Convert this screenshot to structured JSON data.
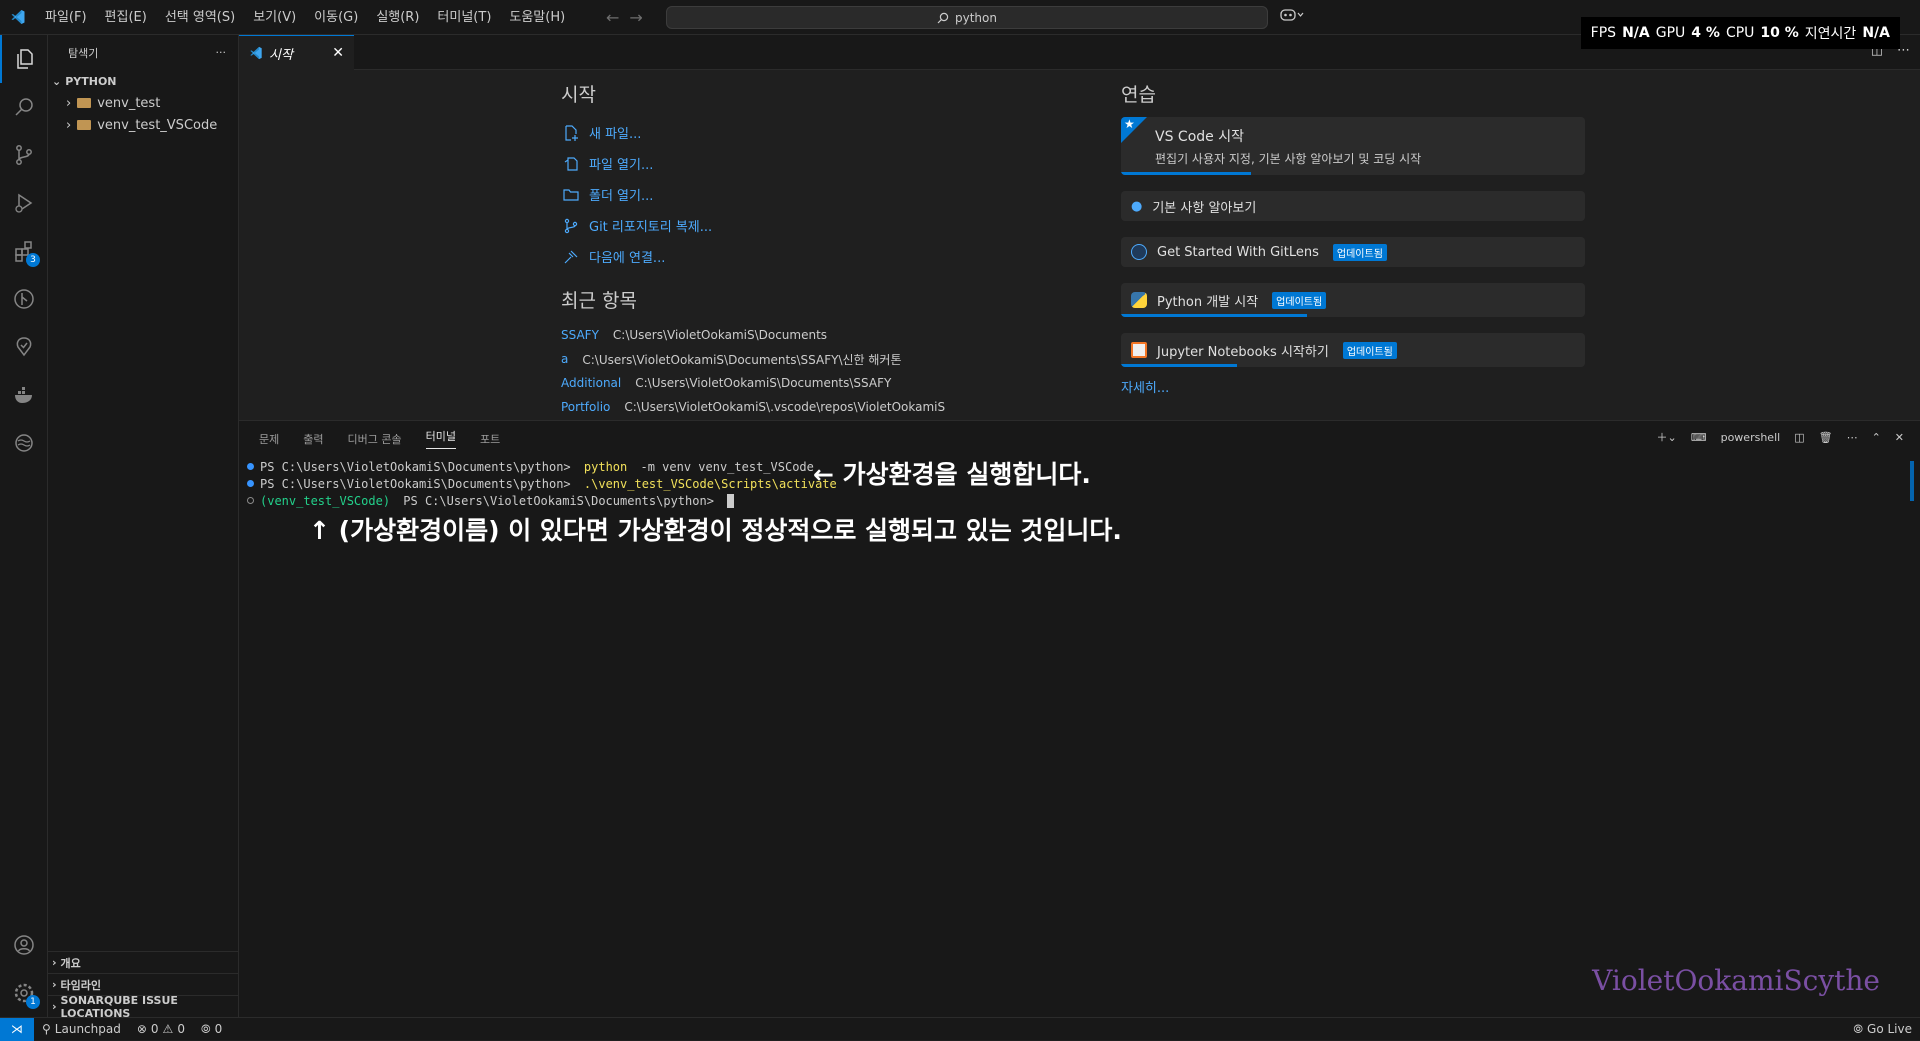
{
  "titlebar": {
    "menu": [
      "파일(F)",
      "편집(E)",
      "선택 영역(S)",
      "보기(V)",
      "이동(G)",
      "실행(R)",
      "터미널(T)",
      "도움말(H)"
    ],
    "search": "python"
  },
  "perf": {
    "fps_label": "FPS",
    "fps": "N/A",
    "gpu_label": "GPU",
    "gpu": "4 %",
    "cpu_label": "CPU",
    "cpu": "10 %",
    "latency_label": "지연시간",
    "latency": "N/A"
  },
  "activity": {
    "extensions_badge": "3",
    "settings_badge": "1"
  },
  "sidebar": {
    "title": "탐색기",
    "more": "···",
    "section": "PYTHON",
    "items": [
      {
        "label": "venv_test"
      },
      {
        "label": "venv_test_VSCode"
      }
    ],
    "bottom_sections": [
      "개요",
      "타임라인",
      "SONARQUBE ISSUE LOCATIONS"
    ]
  },
  "tab": {
    "label": "시작",
    "close": "✕"
  },
  "welcome": {
    "start_title": "시작",
    "start_links": [
      "새 파일...",
      "파일 열기...",
      "폴더 열기...",
      "Git 리포지토리 복제...",
      "다음에 연결..."
    ],
    "recent_title": "최근 항목",
    "recent": [
      {
        "name": "SSAFY",
        "path": "C:\\Users\\VioletOokamiS\\Documents"
      },
      {
        "name": "a",
        "path": "C:\\Users\\VioletOokamiS\\Documents\\SSAFY\\신한 해커톤"
      },
      {
        "name": "Additional",
        "path": "C:\\Users\\VioletOokamiS\\Documents\\SSAFY"
      },
      {
        "name": "Portfolio",
        "path": "C:\\Users\\VioletOokamiS\\.vscode\\repos\\VioletOokamiS"
      }
    ],
    "walk_title": "연습",
    "walk_main_title": "VS Code 시작",
    "walk_main_desc": "편집기 사용자 지정, 기본 사항 알아보기 및 코딩 시작",
    "walk_main_progress": 0.28,
    "walkthroughs": [
      {
        "label": "기본 사항 알아보기",
        "badge": "",
        "progress": 0
      },
      {
        "label": "Get Started With GitLens",
        "badge": "업데이트됨",
        "progress": 0
      },
      {
        "label": "Python 개발 시작",
        "badge": "업데이트됨",
        "progress": 0.4
      },
      {
        "label": "Jupyter Notebooks 시작하기",
        "badge": "업데이트됨",
        "progress": 0.25
      }
    ],
    "more": "자세히..."
  },
  "panel": {
    "tabs": [
      "문제",
      "출력",
      "디버그 콘솔",
      "터미널",
      "포트"
    ],
    "active_tab": "터미널",
    "shell": "powershell",
    "lines": [
      {
        "prompt": "PS C:\\Users\\VioletOokamiS\\Documents\\python> ",
        "cmd": "python",
        "rest": " -m venv venv_test_VSCode"
      },
      {
        "prompt": "PS C:\\Users\\VioletOokamiS\\Documents\\python> ",
        "cmd": ".\\venv_test_VSCode\\Scripts\\activate",
        "rest": ""
      },
      {
        "env": "(venv_test_VSCode)",
        "prompt": " PS C:\\Users\\VioletOokamiS\\Documents\\python> "
      }
    ],
    "annotation1": "← 가상환경을 실행합니다.",
    "annotation2": "↑ (가상환경이름) 이 있다면 가상환경이 정상적으로 실행되고 있는 것입니다.",
    "watermark": "VioletOokamiScythe"
  },
  "statusbar": {
    "launchpad": "Launchpad",
    "errors": "0",
    "warnings": "0",
    "ports": "0",
    "golive": "Go Live"
  }
}
